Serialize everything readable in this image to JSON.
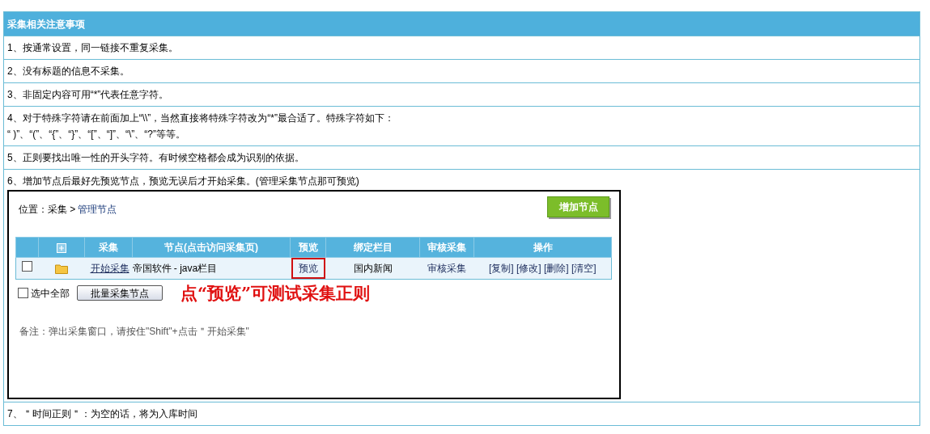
{
  "title": "采集相关注意事项",
  "notes": [
    {
      "lines": [
        "1、按通常设置，同一链接不重复采集。"
      ]
    },
    {
      "lines": [
        "2、没有标题的信息不采集。"
      ]
    },
    {
      "lines": [
        "3、非固定内容可用“*”代表任意字符。"
      ]
    },
    {
      "lines": [
        "4、对于特殊字符请在前面加上“\\\\”，当然直接将特殊字符改为“*”最合适了。特殊字符如下：",
        "“ )”、“(”、“{”、“}”、“[”、“]”、“\\”、“?”等等。"
      ]
    },
    {
      "lines": [
        "5、正则要找出唯一性的开头字符。有时候空格都会成为识别的依据。"
      ]
    },
    {
      "lines": [
        "6、增加节点后最好先预览节点，预览无误后才开始采集。(管理采集节点那可预览)"
      ],
      "panel": {
        "breadcrumb": [
          {
            "kind": "plain",
            "text": "位置：采集 >"
          },
          {
            "kind": "link",
            "text": "管理节点"
          }
        ],
        "add_button": "增加节点",
        "columns": [
          "采集",
          "节点(点击访问采集页)",
          "预览",
          "绑定栏目",
          "审核采集",
          "操作"
        ],
        "rows": [
          {
            "checked": false,
            "start": "开始采集",
            "node": "帝国软件 - java栏目",
            "preview": "预览",
            "preview_highlighted": true,
            "bound_column": "国内新闻",
            "review": "审核采集",
            "actions": [
              "[复制]",
              "[修改]",
              "[删除]",
              "[清空]"
            ]
          }
        ],
        "select_all": {
          "label": "选中全部",
          "checked": false
        },
        "batch_button": "批量采集节点",
        "annotation": "点“预览”可测试采集正则",
        "remark": "备注：弹出采集窗口，请按住\"Shift\"+点击＂开始采集\""
      }
    },
    {
      "lines": [
        "7、＂时间正则＂：为空的话，将为入库时间"
      ]
    }
  ]
}
